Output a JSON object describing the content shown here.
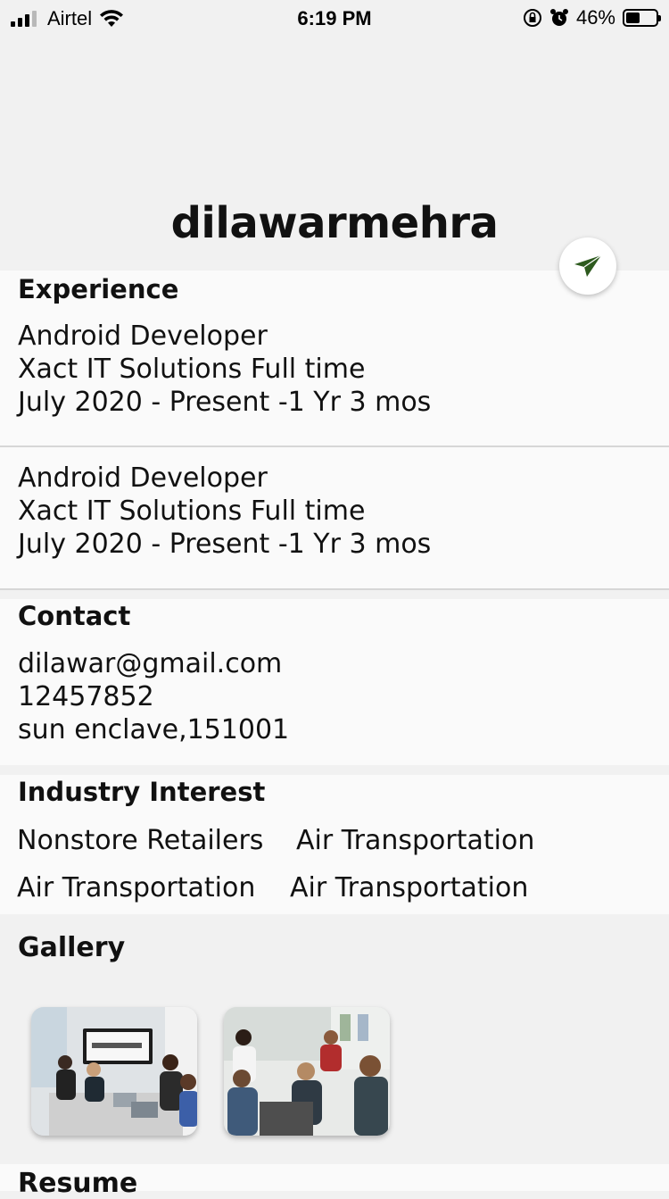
{
  "status": {
    "carrier": "Airtel",
    "time": "6:19 PM",
    "battery": "46%",
    "battery_level": 0.46
  },
  "profile": {
    "name": "dilawarmehra"
  },
  "experience": {
    "title": "Experience",
    "items": [
      {
        "role": "Android Developer",
        "company": "Xact IT Solutions Full time",
        "period": "July 2020 - Present -1 Yr 3 mos"
      },
      {
        "role": "Android Developer",
        "company": "Xact IT Solutions Full time",
        "period": "July 2020 - Present -1 Yr 3 mos"
      }
    ]
  },
  "contact": {
    "title": "Contact",
    "email": "dilawar@gmail.com",
    "phone": "12457852",
    "address": "sun enclave,151001"
  },
  "industry": {
    "title": "Industry Interest",
    "items": [
      "Nonstore Retailers",
      "Air Transportation",
      "Air Transportation",
      "Air Transportation"
    ]
  },
  "gallery": {
    "title": "Gallery"
  },
  "resume": {
    "title": "Resume"
  },
  "icons": {
    "send": "send-icon",
    "wifi": "wifi-icon",
    "orientation_lock": "orientation-lock-icon",
    "alarm": "alarm-icon"
  },
  "colors": {
    "accent": "#2d5a1e",
    "background": "#f1f1f1",
    "card": "#fafafa"
  }
}
